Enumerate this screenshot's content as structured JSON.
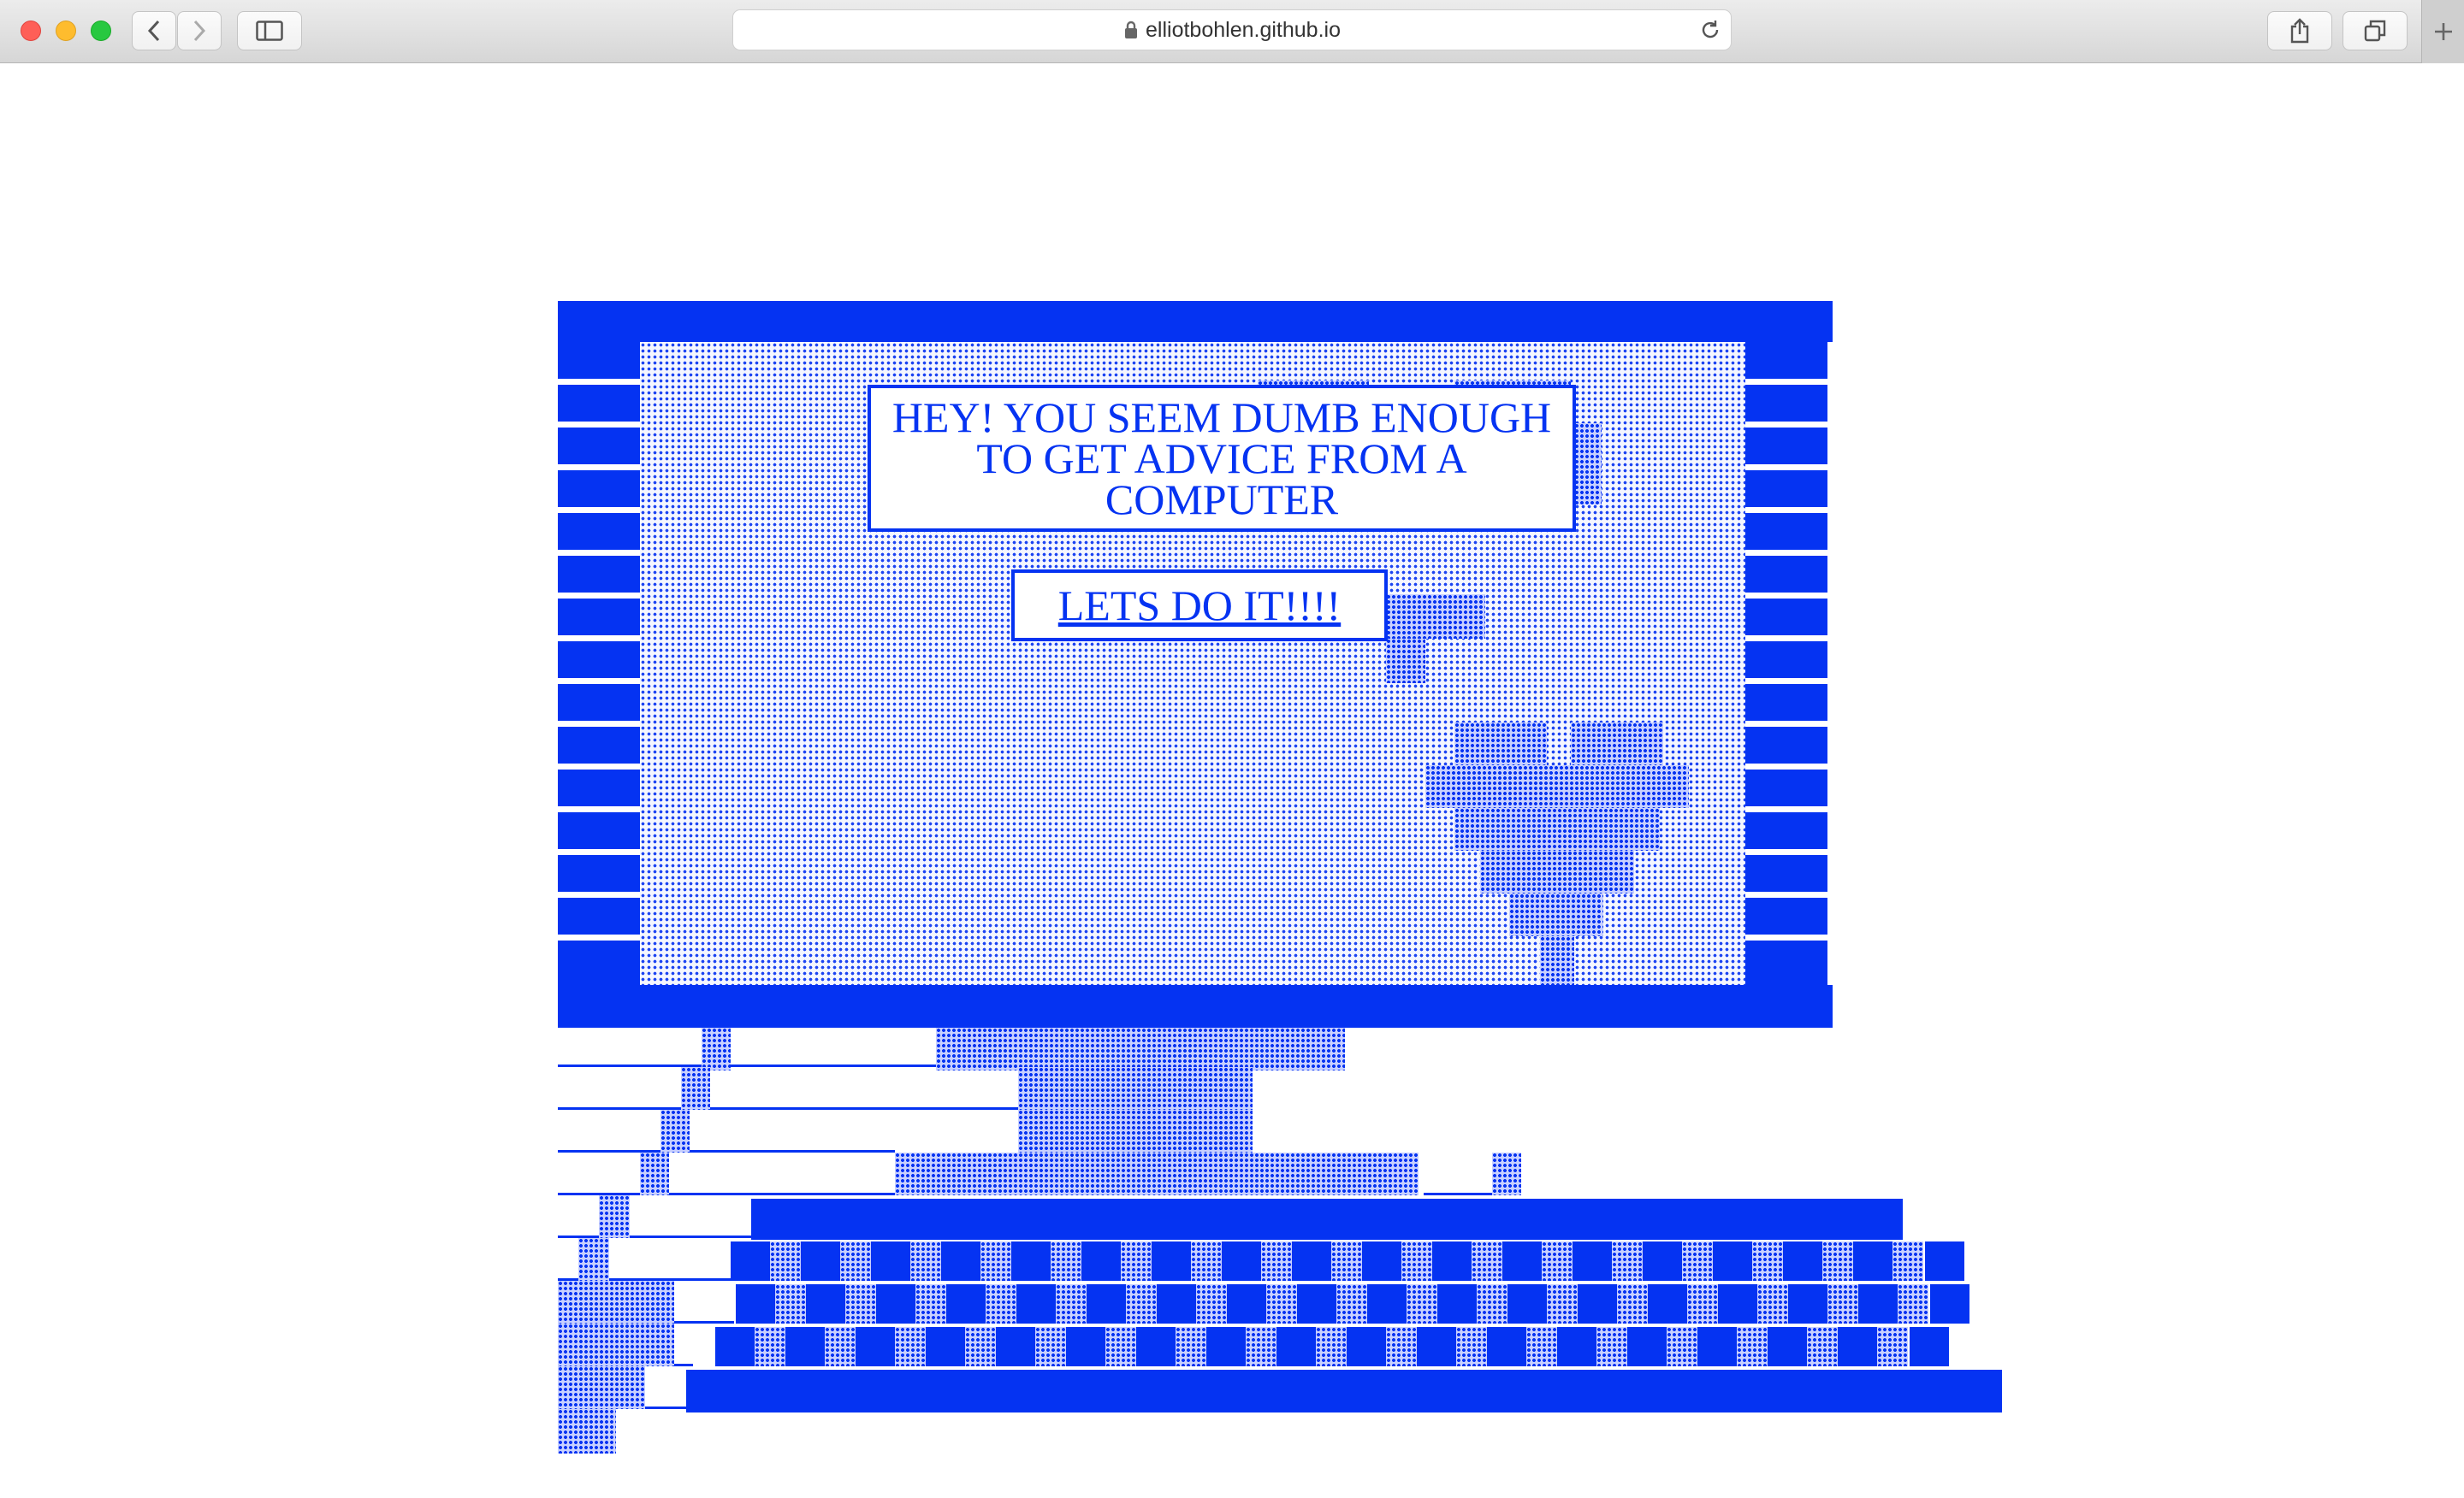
{
  "browser": {
    "url": "elliotbohlen.github.io",
    "icons": {
      "back": "chevron-left-icon",
      "forward": "chevron-right-icon",
      "sidebar": "sidebar-icon",
      "lock": "lock-icon",
      "reload": "reload-icon",
      "share": "share-icon",
      "tabs": "tabs-icon",
      "new_tab": "plus-icon"
    }
  },
  "page": {
    "headline": "HEY! YOU SEEM DUMB ENOUGH TO GET ADVICE FROM A COMPUTER",
    "cta_label": "LETS DO IT!!!!",
    "accent_color": "#0533f2"
  }
}
